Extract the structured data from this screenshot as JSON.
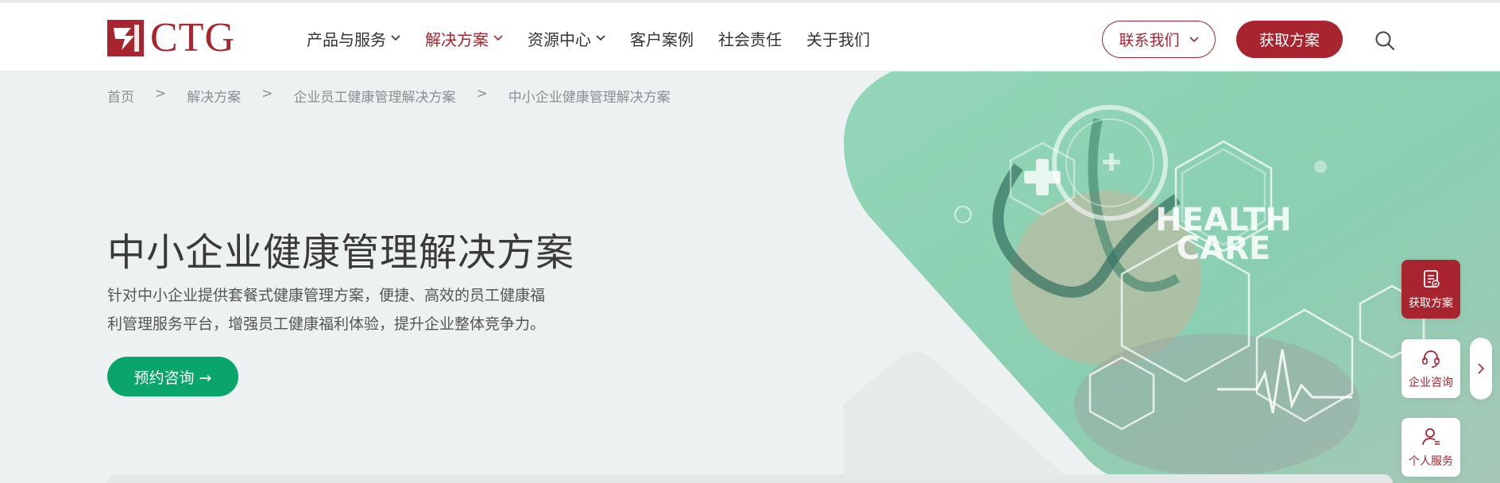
{
  "header": {
    "logo_text": "CTG",
    "nav": [
      {
        "label": "产品与服务",
        "dropdown": true,
        "active": false
      },
      {
        "label": "解决方案",
        "dropdown": true,
        "active": true
      },
      {
        "label": "资源中心",
        "dropdown": true,
        "active": false
      },
      {
        "label": "客户案例",
        "dropdown": false,
        "active": false
      },
      {
        "label": "社会责任",
        "dropdown": false,
        "active": false
      },
      {
        "label": "关于我们",
        "dropdown": false,
        "active": false
      }
    ],
    "contact_label": "联系我们",
    "get_solution_label": "获取方案"
  },
  "breadcrumb": {
    "items": [
      "首页",
      "解决方案",
      "企业员工健康管理解决方案",
      "中小企业健康管理解决方案"
    ],
    "separator": ">"
  },
  "hero": {
    "title": "中小企业健康管理解决方案",
    "desc_line1": "针对中小企业提供套餐式健康管理方案，便捷、高效的员工健康福",
    "desc_line2": "利管理服务平台，增强员工健康福利体验，提升企业整体竞争力。",
    "cta_label": "预约咨询 →",
    "image_text_1": "HEALTH",
    "image_text_2": "CARE"
  },
  "float_panel": {
    "items": [
      {
        "label": "获取方案",
        "icon": "document-icon"
      },
      {
        "label": "企业咨询",
        "icon": "headset-icon"
      },
      {
        "label": "个人服务",
        "icon": "person-icon"
      }
    ]
  },
  "colors": {
    "brand": "#a8242e",
    "cta_green": "#0aa56a",
    "hero_bg": "#edf1f1",
    "visual_green": "#8fd2b5"
  }
}
